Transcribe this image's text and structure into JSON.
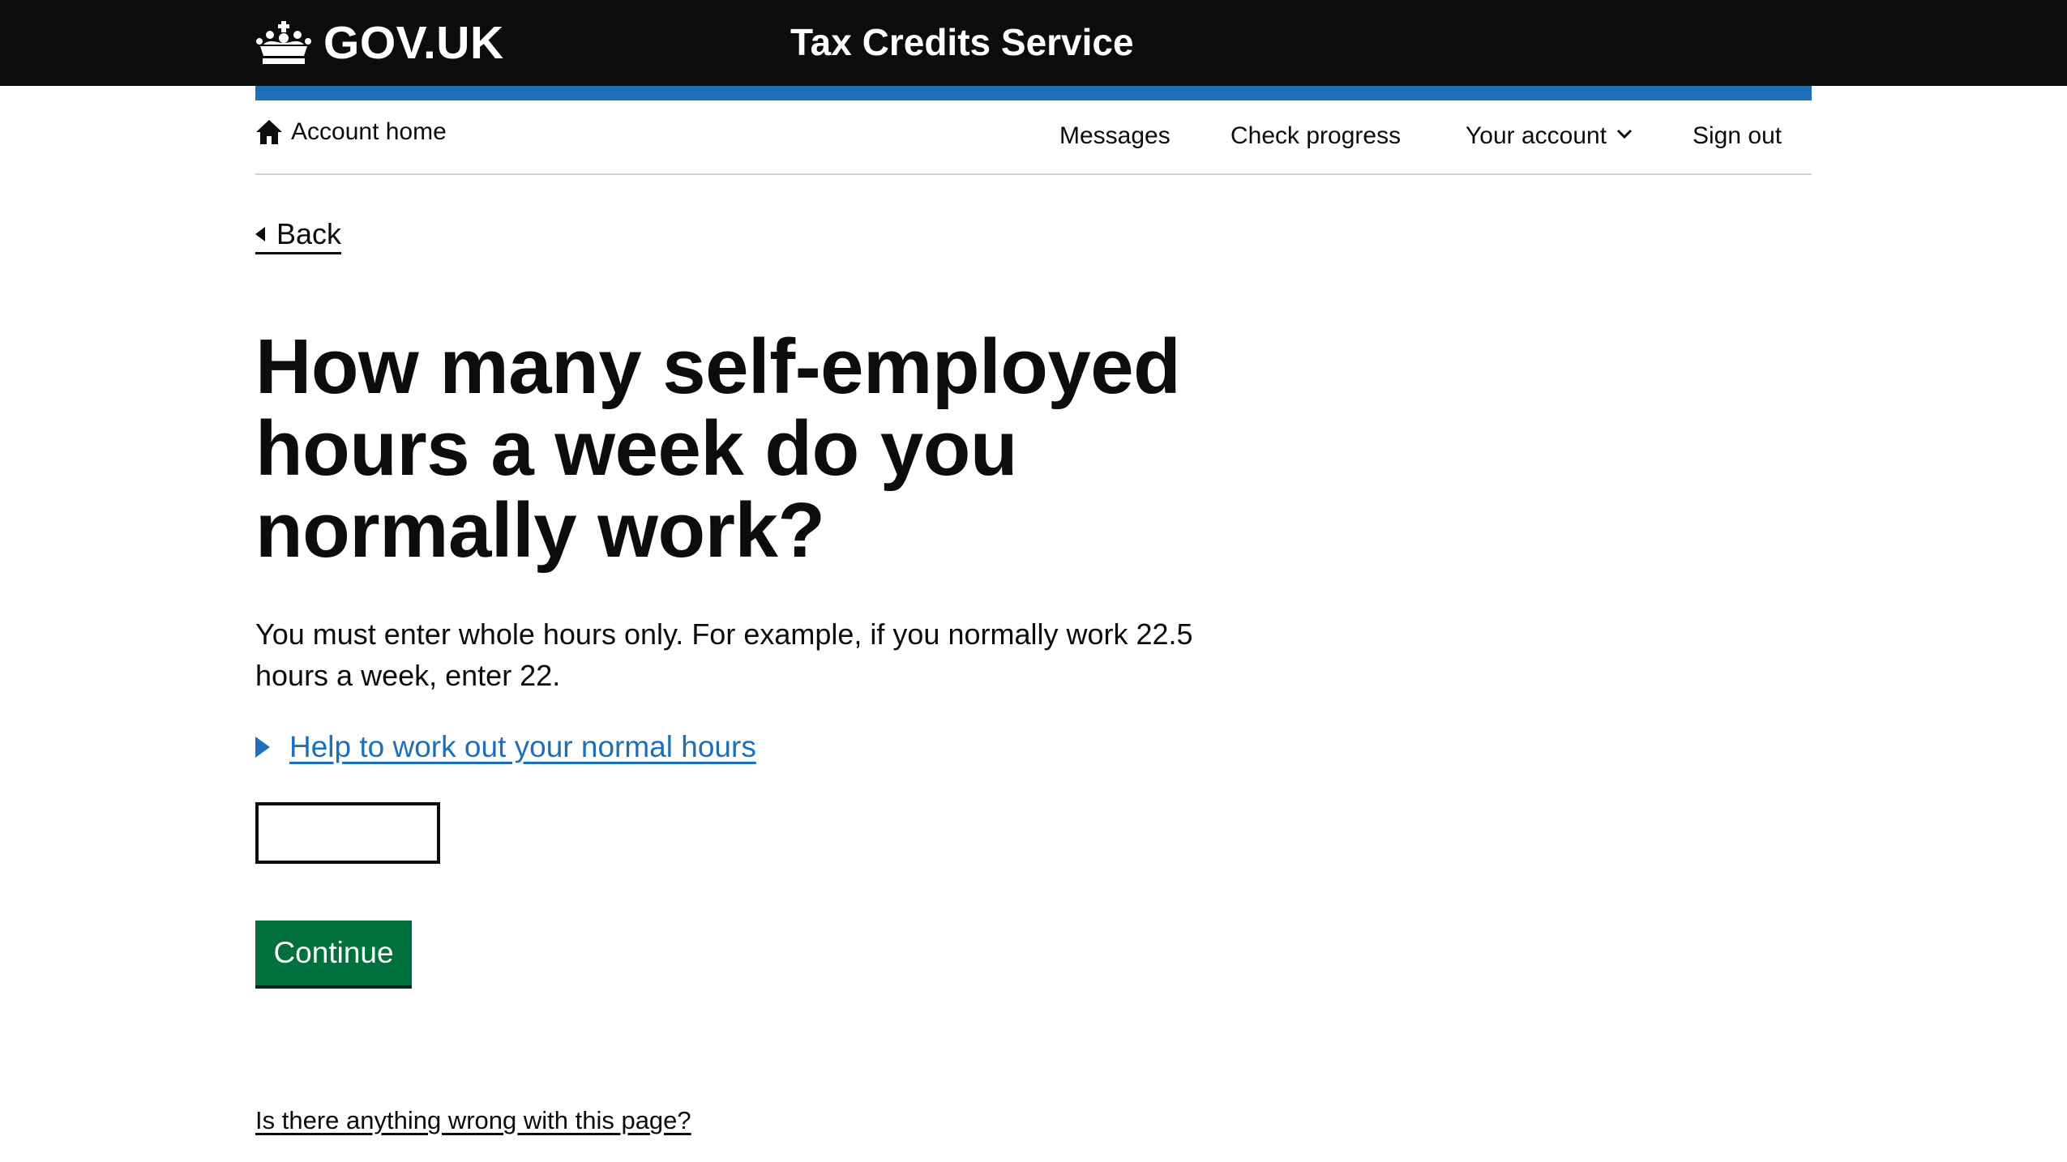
{
  "header": {
    "logo_text": "GOV.UK",
    "service_name": "Tax Credits Service",
    "crown_icon": "crown-icon",
    "background": "#0b0c0c",
    "accent": "#1d70b8"
  },
  "nav": {
    "home_icon": "home-icon",
    "account_home": "Account home",
    "messages": "Messages",
    "check_progress": "Check progress",
    "your_account": "Your account",
    "sign_out": "Sign out"
  },
  "back_label": "Back",
  "page_title": "How many self-employed hours a week do you normally work?",
  "hint_text": "You must enter whole hours only. For example, if you normally work 22.5 hours a week, enter 22.",
  "details_summary": "Help to work out your normal hours",
  "hours_input": {
    "value": "",
    "placeholder": ""
  },
  "continue_label": "Continue",
  "continue_color": "#00703c",
  "report_link": "Is there anything wrong with this page?"
}
